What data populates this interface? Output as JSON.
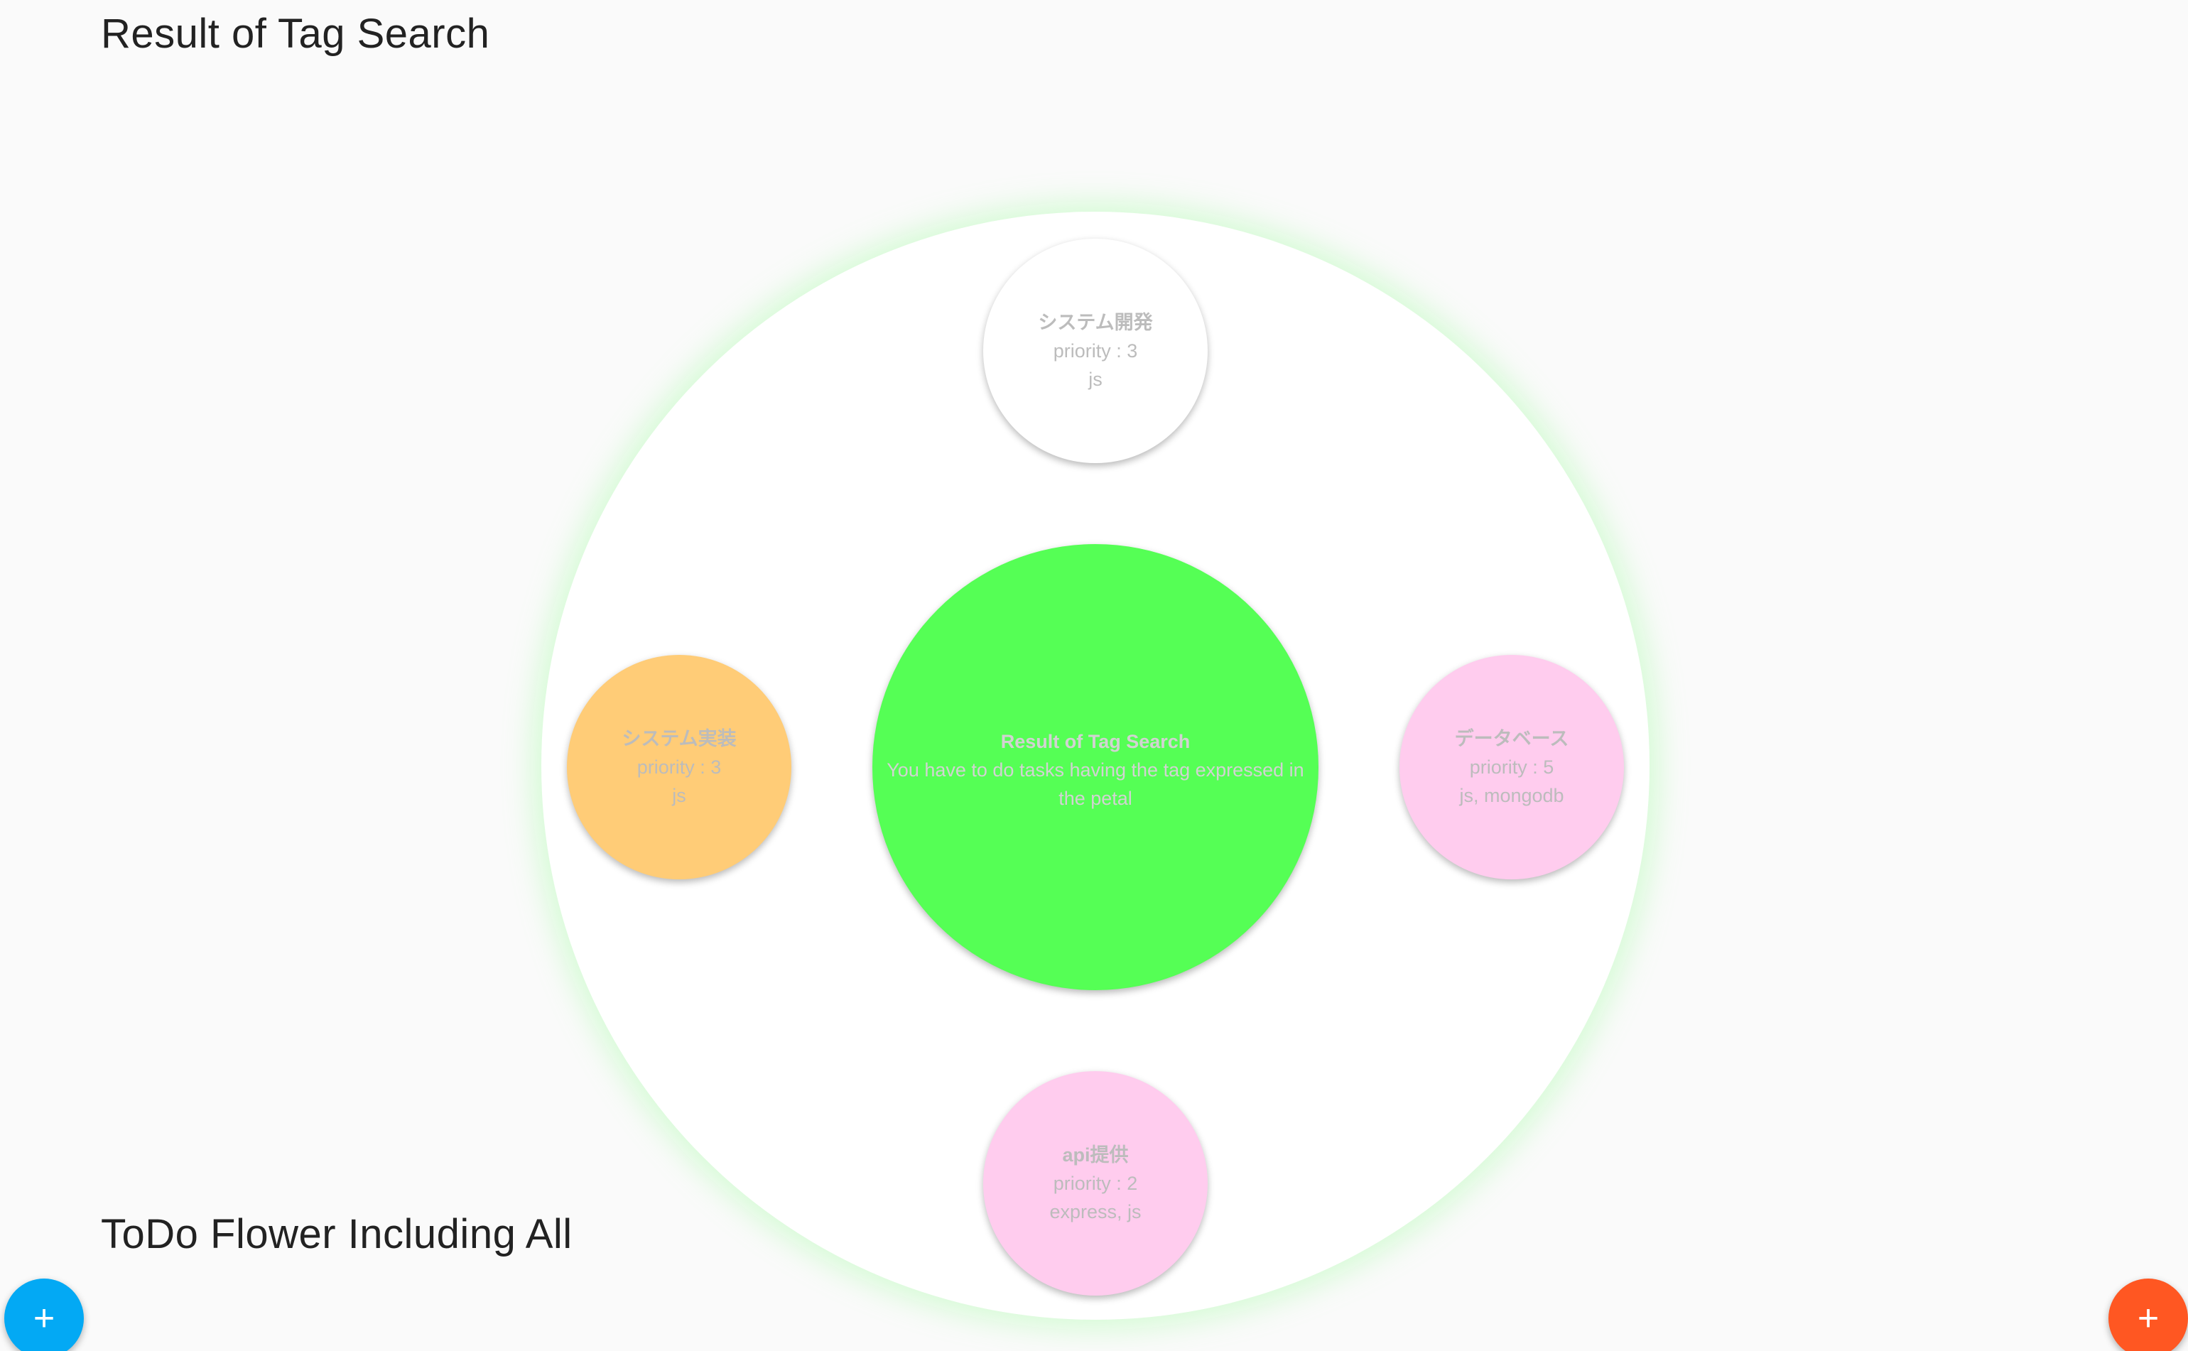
{
  "header": {
    "title": "Result of Tag Search"
  },
  "footer": {
    "title": "ToDo Flower Including All"
  },
  "flower": {
    "center": {
      "title": "Result of Tag Search",
      "description": "You have to do tasks having the tag expressed in the petal",
      "color": "#55ff55"
    },
    "petals": [
      {
        "title": "システム開発",
        "priority": "priority : 3",
        "tags": "js",
        "color": "#ffffff"
      },
      {
        "title": "システム実装",
        "priority": "priority : 3",
        "tags": "js",
        "color": "#ffcc77"
      },
      {
        "title": "データベース",
        "priority": "priority : 5",
        "tags": "js, mongodb",
        "color": "#ffccee"
      },
      {
        "title": "api提供",
        "priority": "priority : 2",
        "tags": "express, js",
        "color": "#ffccee"
      }
    ]
  },
  "buttons": {
    "add_left": {
      "label": "+",
      "color": "#03a9f4"
    },
    "add_right": {
      "label": "+",
      "color": "#ff5722"
    }
  }
}
